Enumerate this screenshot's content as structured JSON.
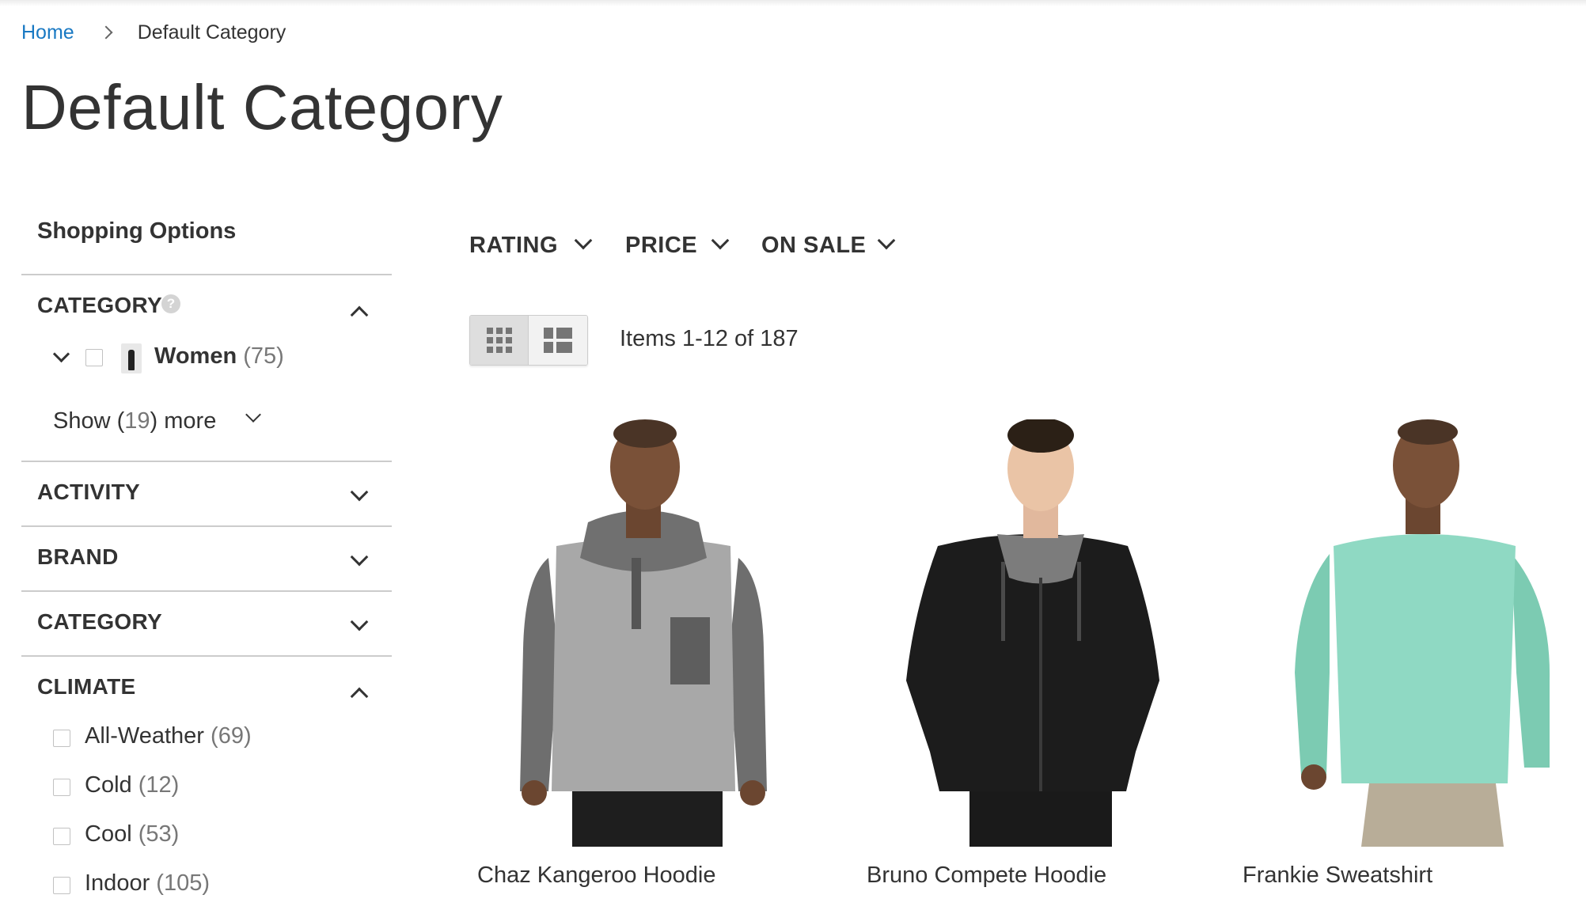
{
  "breadcrumb": {
    "home": "Home",
    "current": "Default Category"
  },
  "page_title": "Default Category",
  "sidebar": {
    "shopping_options": "Shopping Options",
    "category": {
      "title": "CATEGORY",
      "help_icon": "question-icon",
      "expanded": true,
      "items": [
        {
          "label": "Women",
          "count": "(75)"
        }
      ],
      "show_more_prefix": "Show (",
      "show_more_count": "19",
      "show_more_suffix": ") more"
    },
    "collapsed_filters": [
      {
        "title": "ACTIVITY"
      },
      {
        "title": "BRAND"
      },
      {
        "title": "CATEGORY"
      }
    ],
    "climate": {
      "title": "CLIMATE",
      "expanded": true,
      "options": [
        {
          "label": "All-Weather",
          "count": "(69)"
        },
        {
          "label": "Cold",
          "count": "(12)"
        },
        {
          "label": "Cool",
          "count": "(53)"
        },
        {
          "label": "Indoor",
          "count": "(105)"
        }
      ]
    }
  },
  "top_filters": [
    {
      "label": "RATING"
    },
    {
      "label": "PRICE"
    },
    {
      "label": "ON SALE"
    }
  ],
  "toolbar": {
    "grid_icon": "grid-view-icon",
    "list_icon": "list-view-icon",
    "items_count": "Items 1-12 of 187"
  },
  "products": [
    {
      "name": "Chaz Kangeroo Hoodie",
      "color": "#a8a8a8"
    },
    {
      "name": "Bruno Compete Hoodie",
      "color": "#1c1c1c"
    },
    {
      "name": "Frankie Sweatshirt",
      "color": "#8fd9c3"
    }
  ],
  "colors": {
    "link": "#1979c3",
    "text": "#333333",
    "divider": "#cccccc"
  }
}
